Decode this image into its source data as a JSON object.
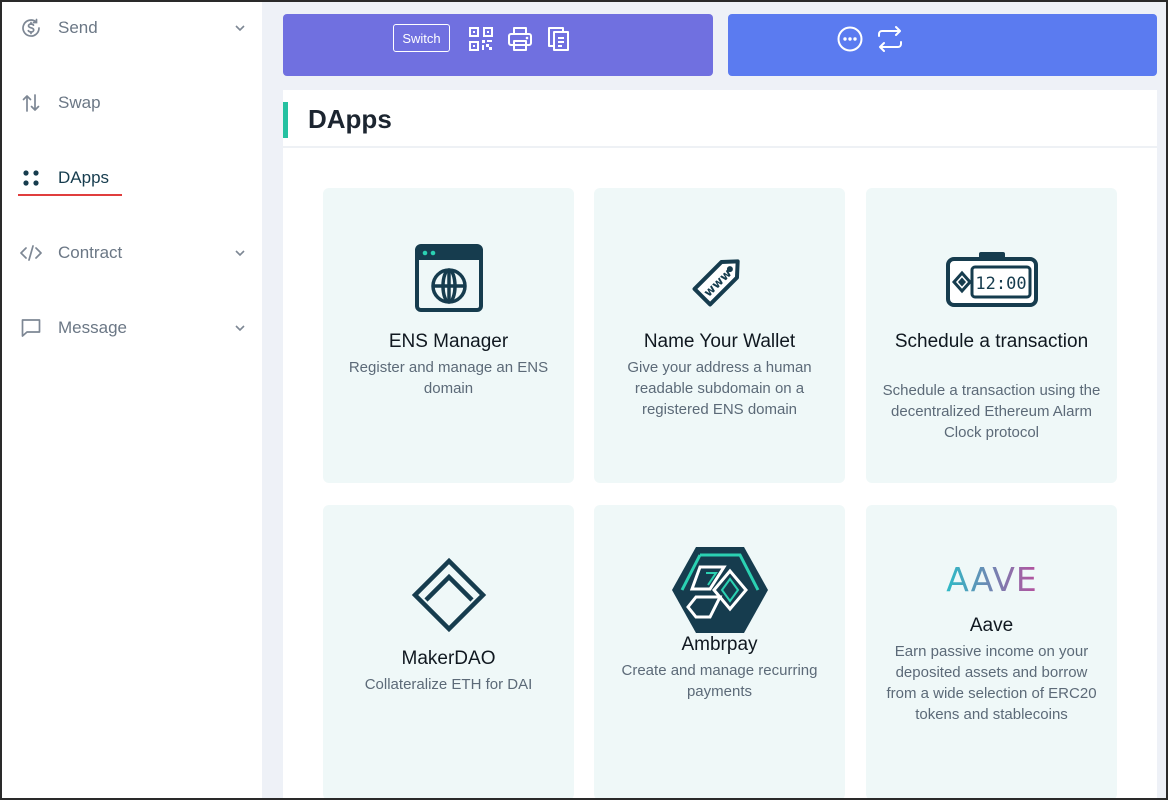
{
  "sidebar": {
    "items": [
      {
        "label": "Send",
        "icon": "dollar-circle-icon",
        "has_chevron": true
      },
      {
        "label": "Swap",
        "icon": "swap-arrows-icon",
        "has_chevron": false
      },
      {
        "label": "DApps",
        "icon": "dots-grid-icon",
        "has_chevron": false,
        "active": true
      },
      {
        "label": "Contract",
        "icon": "code-icon",
        "has_chevron": true
      },
      {
        "label": "Message",
        "icon": "message-icon",
        "has_chevron": true
      }
    ]
  },
  "top_cards": {
    "switch_label": "Switch",
    "left_icons": [
      "qr-code-icon",
      "printer-icon",
      "copy-icon"
    ],
    "right_icons": [
      "more-icon",
      "transfer-icon"
    ],
    "left_color": "#7070e0",
    "right_color": "#5b7bf0"
  },
  "panel": {
    "title": "DApps",
    "accent_color": "#25c1a1"
  },
  "dapps": [
    {
      "title": "ENS Manager",
      "description": "Register and manage an ENS domain",
      "icon": "browser-globe-icon"
    },
    {
      "title": "Name Your Wallet",
      "description": "Give your address a human readable subdomain on a registered ENS domain",
      "icon": "www-tag-icon"
    },
    {
      "title": "Schedule a transaction",
      "description": "Schedule a transaction using the decentralized Ethereum Alarm Clock protocol",
      "icon": "alarm-clock-icon",
      "clock_text": "12:00"
    },
    {
      "title": "MakerDAO",
      "description": "Collateralize ETH for DAI",
      "icon": "makerdao-logo-icon"
    },
    {
      "title": "Ambrpay",
      "description": "Create and manage recurring payments",
      "icon": "ambrpay-logo-icon"
    },
    {
      "title": "Aave",
      "description": "Earn passive income on your deposited assets and borrow from a wide selection of ERC20 tokens and stablecoins",
      "icon": "aave-logo-icon",
      "logo_text": "AAVE"
    }
  ]
}
